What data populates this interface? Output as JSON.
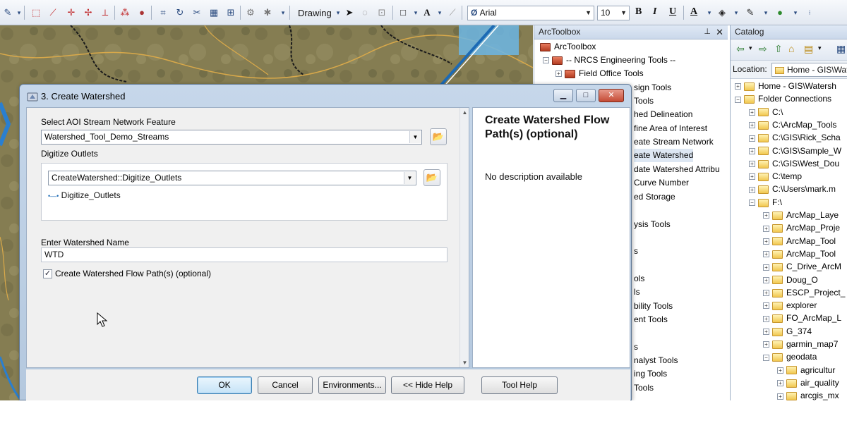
{
  "toolbar": {
    "drawing_label": "Drawing",
    "font_name": "Arial",
    "font_size": "10",
    "bold": "B",
    "italic": "I",
    "underline": "U",
    "font_color": "A"
  },
  "dialog": {
    "title": "3. Create Watershed",
    "aoi_label": "Select AOI Stream Network Feature",
    "aoi_value": "Watershed_Tool_Demo_Streams",
    "outlets_label": "Digitize Outlets",
    "outlets_value": "CreateWatershed::Digitize_Outlets",
    "outlets_item": "Digitize_Outlets",
    "name_label": "Enter Watershed Name",
    "name_value": "WTD",
    "flowpath_label": "Create Watershed Flow Path(s) (optional)",
    "help_title": "Create Watershed Flow Path(s) (optional)",
    "help_desc": "No description available",
    "buttons": {
      "ok": "OK",
      "cancel": "Cancel",
      "environments": "Environments...",
      "hide_help": "<< Hide Help",
      "tool_help": "Tool Help"
    }
  },
  "arctoolbox": {
    "title": "ArcToolbox",
    "root": "ArcToolbox",
    "group": "-- NRCS Engineering Tools --",
    "items": [
      "Field Office Tools",
      "sign Tools",
      "Tools",
      "hed Delineation",
      "fine Area of Interest",
      "eate Stream Network",
      "eate Watershed",
      "date Watershed Attribu",
      "Curve Number",
      "ed Storage",
      "ysis Tools",
      "s",
      "ols",
      "ls",
      "bility Tools",
      "ent Tools",
      "s",
      "nalyst Tools",
      "ing Tools",
      "Tools"
    ]
  },
  "catalog": {
    "title": "Catalog",
    "location_label": "Location:",
    "location_value": "Home - GIS\\Wate",
    "tree": [
      {
        "label": "Home - GIS\\Watersh",
        "indent": 0
      },
      {
        "label": "Folder Connections",
        "indent": 0
      },
      {
        "label": "C:\\",
        "indent": 1
      },
      {
        "label": "C:\\ArcMap_Tools",
        "indent": 1
      },
      {
        "label": "C:\\GIS\\Rick_Scha",
        "indent": 1
      },
      {
        "label": "C:\\GIS\\Sample_W",
        "indent": 1
      },
      {
        "label": "C:\\GIS\\West_Dou",
        "indent": 1
      },
      {
        "label": "C:\\temp",
        "indent": 1
      },
      {
        "label": "C:\\Users\\mark.m",
        "indent": 1
      },
      {
        "label": "F:\\",
        "indent": 1
      },
      {
        "label": "ArcMap_Laye",
        "indent": 2
      },
      {
        "label": "ArcMap_Proje",
        "indent": 2
      },
      {
        "label": "ArcMap_Tool",
        "indent": 2
      },
      {
        "label": "ArcMap_Tool",
        "indent": 2
      },
      {
        "label": "C_Drive_ArcM",
        "indent": 2
      },
      {
        "label": "Doug_O",
        "indent": 2
      },
      {
        "label": "ESCP_Project_",
        "indent": 2
      },
      {
        "label": "explorer",
        "indent": 2
      },
      {
        "label": "FO_ArcMap_L",
        "indent": 2
      },
      {
        "label": "G_374",
        "indent": 2
      },
      {
        "label": "garmin_map7",
        "indent": 2
      },
      {
        "label": "geodata",
        "indent": 2
      },
      {
        "label": "agricultur",
        "indent": 3
      },
      {
        "label": "air_quality",
        "indent": 3
      },
      {
        "label": "arcgis_mx",
        "indent": 3
      }
    ]
  }
}
